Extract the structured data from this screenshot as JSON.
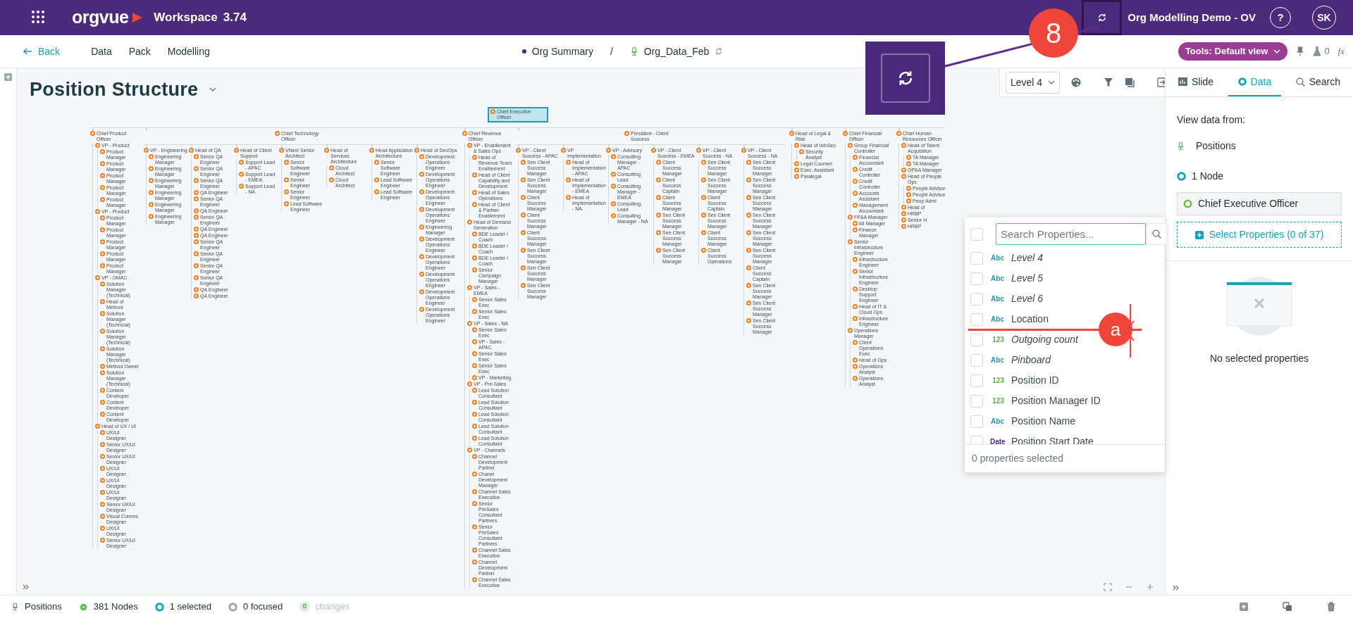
{
  "app": {
    "logo": "orgvue",
    "workspace": "Workspace",
    "version": "3.74",
    "project": "Org Modelling Demo - OV",
    "help": "?",
    "user_initials": "SK"
  },
  "annotations": {
    "step_badge": "8",
    "marker": "a"
  },
  "subnav": {
    "back": "Back",
    "links": [
      "Data",
      "Pack",
      "Modelling"
    ],
    "breadcrumb": [
      "Org Summary",
      "Org_Data_Feb"
    ],
    "separator": "/",
    "tools": "Tools: Default view",
    "flask_count": "0",
    "formula": "fx"
  },
  "view": {
    "title": "Position Structure",
    "level_select": "Level 4"
  },
  "org_chart": {
    "root": {
      "title": "Chief Executive Officer",
      "selected": true,
      "children": [
        {
          "title": "Chief Product Officer",
          "selected": false,
          "kind": "stacked",
          "children": [
            {
              "title": "VP - Product",
              "selected": false,
              "children": [
                {
                  "title": "Product Manager",
                  "selected": false
                },
                {
                  "title": "Product Manager",
                  "selected": false
                },
                {
                  "title": "Product Manager",
                  "selected": false
                },
                {
                  "title": "Product Manager",
                  "selected": false
                },
                {
                  "title": "Product Manager",
                  "selected": false
                }
              ]
            },
            {
              "title": "VP - Product",
              "selected": false,
              "children": [
                {
                  "title": "Product Manager",
                  "selected": false
                },
                {
                  "title": "Product Manager",
                  "selected": false
                },
                {
                  "title": "Product Manager",
                  "selected": false
                },
                {
                  "title": "Product Manager",
                  "selected": false
                },
                {
                  "title": "Product Manager",
                  "selected": false
                }
              ]
            },
            {
              "title": "VP - OMAC",
              "selected": false,
              "children": [
                {
                  "title": "Solution Manager (Technical)",
                  "selected": false
                },
                {
                  "title": "Head of Method",
                  "selected": false
                },
                {
                  "title": "Solution Manager (Technical)",
                  "selected": false
                },
                {
                  "title": "Solution Manager (Technical)",
                  "selected": false
                },
                {
                  "title": "Solution Manager (Technical)",
                  "selected": false
                },
                {
                  "title": "Method Owner",
                  "selected": false
                },
                {
                  "title": "Solution Manager (Technical)",
                  "selected": false
                },
                {
                  "title": "Content Developer",
                  "selected": false
                },
                {
                  "title": "Content Developer",
                  "selected": false
                },
                {
                  "title": "Content Developer",
                  "selected": false
                }
              ]
            },
            {
              "title": "Head of UX / UI",
              "selected": false,
              "children": [
                {
                  "title": "UX/UI Designer",
                  "selected": false
                },
                {
                  "title": "Senior UX/UI Designer",
                  "selected": false
                },
                {
                  "title": "Senior UX/UI Designer",
                  "selected": false
                },
                {
                  "title": "UX/UI Designer",
                  "selected": false
                },
                {
                  "title": "UX/UI Designer",
                  "selected": false
                },
                {
                  "title": "UX/UI Designer",
                  "selected": false
                },
                {
                  "title": "Senior UX/UI Designer",
                  "selected": false
                },
                {
                  "title": "Visual Comms Designer",
                  "selected": false
                },
                {
                  "title": "UX/UI Designer",
                  "selected": false
                },
                {
                  "title": "Senior UX/UI Designer",
                  "selected": false
                }
              ]
            }
          ]
        },
        {
          "title": "Chief Technology Officer",
          "selected": false,
          "kind": "spread",
          "children": [
            {
              "title": "VP - Engineering",
              "selected": false,
              "children": [
                {
                  "title": "Engineering Manager",
                  "selected": false
                },
                {
                  "title": "Engineering Manager",
                  "selected": false
                },
                {
                  "title": "Engineering Manager",
                  "selected": false
                },
                {
                  "title": "Engineering Manager",
                  "selected": false
                },
                {
                  "title": "Engineering Manager",
                  "selected": false
                },
                {
                  "title": "Engineering Manager",
                  "selected": false
                }
              ]
            },
            {
              "title": "Head of QA",
              "selected": false,
              "children": [
                {
                  "title": "Senior QA Engineer",
                  "selected": false
                },
                {
                  "title": "Senior QA Engineer",
                  "selected": false
                },
                {
                  "title": "Senior QA Engineer",
                  "selected": false
                },
                {
                  "title": "QA Engineer",
                  "selected": false
                },
                {
                  "title": "Senior QA Engineer",
                  "selected": false
                },
                {
                  "title": "QA Engineer",
                  "selected": false
                },
                {
                  "title": "Senior QA Engineer",
                  "selected": false
                },
                {
                  "title": "QA Engineer",
                  "selected": false
                },
                {
                  "title": "QA Engineer",
                  "selected": false
                },
                {
                  "title": "Senior QA Engineer",
                  "selected": false
                },
                {
                  "title": "Senior QA Engineer",
                  "selected": false
                },
                {
                  "title": "Senior QA Engineer",
                  "selected": false
                },
                {
                  "title": "Senior QA Engineer",
                  "selected": false
                },
                {
                  "title": "QA Engineer",
                  "selected": false
                },
                {
                  "title": "QA Engineer",
                  "selected": false
                }
              ]
            },
            {
              "title": "Head of Client Support",
              "selected": false,
              "children": [
                {
                  "title": "Support Lead - APAC",
                  "selected": false
                },
                {
                  "title": "Support Lead - EMEA",
                  "selected": false
                },
                {
                  "title": "Support Lead - NA",
                  "selected": false
                }
              ]
            },
            {
              "title": "VNext Senior Architect",
              "selected": false,
              "children": [
                {
                  "title": "Senior Software Engineer",
                  "selected": false
                },
                {
                  "title": "Senior Engineer",
                  "selected": false
                },
                {
                  "title": "Senior Engineer",
                  "selected": false
                },
                {
                  "title": "Lead Software Engineer",
                  "selected": false
                }
              ]
            },
            {
              "title": "Head of Services Architecture",
              "selected": false,
              "children": [
                {
                  "title": "Cloud Architect",
                  "selected": false
                },
                {
                  "title": "Cloud Architect",
                  "selected": false
                }
              ]
            },
            {
              "title": "Head Application Architecture",
              "selected": false,
              "children": [
                {
                  "title": "Senior Software Engineer",
                  "selected": false
                },
                {
                  "title": "Lead Software Engineer",
                  "selected": false
                },
                {
                  "title": "Lead Software Engineer",
                  "selected": false
                }
              ]
            },
            {
              "title": "Head of DevOps",
              "selected": false,
              "children": [
                {
                  "title": "Development Operations Engineer",
                  "selected": false
                },
                {
                  "title": "Development Operations Engineer",
                  "selected": false
                },
                {
                  "title": "Development Operations Engineer",
                  "selected": false
                },
                {
                  "title": "Development Operations Engineer",
                  "selected": false
                },
                {
                  "title": "Engineering Manager",
                  "selected": false
                },
                {
                  "title": "Development Operations Engineer",
                  "selected": false
                },
                {
                  "title": "Development Operations Engineer",
                  "selected": false
                },
                {
                  "title": "Development Operations Engineer",
                  "selected": false
                },
                {
                  "title": "Development Operations Engineer",
                  "selected": false
                },
                {
                  "title": "Development Operations Engineer",
                  "selected": false
                }
              ]
            }
          ]
        },
        {
          "title": "Chief Revenue Officer",
          "selected": false,
          "kind": "stacked",
          "children": [
            {
              "title": "VP - Enablement & Sales Ops",
              "selected": false,
              "children": [
                {
                  "title": "Head of Revenue Team Enablement",
                  "selected": false
                },
                {
                  "title": "Head of Client Capability and Development",
                  "selected": false
                },
                {
                  "title": "Head of Sales Operations",
                  "selected": false
                },
                {
                  "title": "Head of Client & Partner Enablement",
                  "selected": false
                }
              ]
            },
            {
              "title": "Head of Demand Generation",
              "selected": false,
              "children": [
                {
                  "title": "BDE Leader / Coach",
                  "selected": false
                },
                {
                  "title": "BDE Leader / Coach",
                  "selected": false
                },
                {
                  "title": "BDE Leader / Coach",
                  "selected": false
                },
                {
                  "title": "Senior Campaign Manager",
                  "selected": false
                }
              ]
            },
            {
              "title": "VP - Sales - EMEA",
              "selected": false,
              "children": [
                {
                  "title": "Senior Sales Exec",
                  "selected": false
                },
                {
                  "title": "Senior Sales Exec",
                  "selected": false
                }
              ]
            },
            {
              "title": "VP - Sales - NA",
              "selected": false,
              "children": [
                {
                  "title": "Senior Sales Exec",
                  "selected": false
                },
                {
                  "title": "VP - Sales - APAC",
                  "selected": false
                },
                {
                  "title": "Senior Sales Exec",
                  "selected": false
                },
                {
                  "title": "Senior Sales Exec",
                  "selected": false
                },
                {
                  "title": "VP - Marketing",
                  "selected": false
                }
              ]
            },
            {
              "title": "VP - Pre-Sales",
              "selected": false,
              "children": [
                {
                  "title": "Lead Solution Consultant",
                  "selected": false
                },
                {
                  "title": "Lead Solution Consultant",
                  "selected": false
                },
                {
                  "title": "Lead Solution Consultant",
                  "selected": false
                },
                {
                  "title": "Lead Solution Consultant",
                  "selected": false
                },
                {
                  "title": "Lead Solution Consultant",
                  "selected": false
                }
              ]
            },
            {
              "title": "VP - Channels",
              "selected": false,
              "children": [
                {
                  "title": "Channel Development Partner",
                  "selected": false
                },
                {
                  "title": "Chanel Development Manager",
                  "selected": false
                },
                {
                  "title": "Channel Sales Executive",
                  "selected": false
                },
                {
                  "title": "Senior PreSales Consultant Partners",
                  "selected": false
                },
                {
                  "title": "Senior PreSales Consultant Partners",
                  "selected": false
                },
                {
                  "title": "Channel Sales Executive",
                  "selected": false
                },
                {
                  "title": "Channel Development Partner",
                  "selected": false
                },
                {
                  "title": "Channel Sales Executive",
                  "selected": false
                }
              ]
            }
          ]
        },
        {
          "title": "President - Client Success",
          "selected": false,
          "kind": "spread",
          "children": [
            {
              "title": "VP - Client Success - APAC",
              "selected": false,
              "children": [
                {
                  "title": "Sen Client Success Manager",
                  "selected": false
                },
                {
                  "title": "Sen Client Success Manager",
                  "selected": false
                },
                {
                  "title": "Client Success Manager",
                  "selected": false
                },
                {
                  "title": "Client Success Manager",
                  "selected": false
                },
                {
                  "title": "Client Success Manager",
                  "selected": false
                },
                {
                  "title": "Sen Client Success Manager",
                  "selected": false
                },
                {
                  "title": "Sen Client Success Manager",
                  "selected": false
                },
                {
                  "title": "Sen Client Success Manager",
                  "selected": false
                }
              ]
            },
            {
              "title": "VP Implementation",
              "selected": false,
              "children": [
                {
                  "title": "Head of Implementation - APAC",
                  "selected": false
                },
                {
                  "title": "Head of Implementation - EMEA",
                  "selected": false
                },
                {
                  "title": "Head of Implementation - NA",
                  "selected": false
                }
              ]
            },
            {
              "title": "VP - Advisory",
              "selected": false,
              "children": [
                {
                  "title": "Consulting Manager - APAC",
                  "selected": false
                },
                {
                  "title": "Consulting Lead",
                  "selected": false
                },
                {
                  "title": "Consulting Manager - EMEA",
                  "selected": false
                },
                {
                  "title": "Consulting Lead",
                  "selected": false
                },
                {
                  "title": "Consulting Manager - NA",
                  "selected": false
                }
              ]
            },
            {
              "title": "VP - Client Success - EMEA",
              "selected": false,
              "children": [
                {
                  "title": "Client Success Manager",
                  "selected": false
                },
                {
                  "title": "Client Success Captain",
                  "selected": false
                },
                {
                  "title": "Client Success Manager",
                  "selected": false
                },
                {
                  "title": "Sen Client Success Manager",
                  "selected": false
                },
                {
                  "title": "Sen Client Success Manager",
                  "selected": false
                },
                {
                  "title": "Sen Client Success Manager",
                  "selected": false
                }
              ]
            },
            {
              "title": "VP - Client Success - NA",
              "selected": false,
              "children": [
                {
                  "title": "Sen Client Success Manager",
                  "selected": false
                },
                {
                  "title": "Sen Client Success Manager",
                  "selected": false
                },
                {
                  "title": "Client Success Captain",
                  "selected": false
                },
                {
                  "title": "Sen Client Success Manager",
                  "selected": false
                },
                {
                  "title": "Client Success Manager",
                  "selected": false
                },
                {
                  "title": "Client Success Operations",
                  "selected": false
                }
              ]
            },
            {
              "title": "VP - Client Success - NA",
              "selected": false,
              "children": [
                {
                  "title": "Sen Client Success Manager",
                  "selected": false
                },
                {
                  "title": "Sen Client Success Manager",
                  "selected": false
                },
                {
                  "title": "Sen Client Success Manager",
                  "selected": false
                },
                {
                  "title": "Sen Client Success Manager",
                  "selected": false
                },
                {
                  "title": "Sen Client Success Manager",
                  "selected": false
                },
                {
                  "title": "Sen Client Success Manager",
                  "selected": false
                },
                {
                  "title": "Client Success Captain",
                  "selected": false
                },
                {
                  "title": "Sen Client Success Manager",
                  "selected": false
                },
                {
                  "title": "Sen Client Success Manager",
                  "selected": false
                },
                {
                  "title": "Sen Client Success Manager",
                  "selected": false
                }
              ]
            }
          ]
        },
        {
          "title": "Head of Legal & Risk",
          "selected": false,
          "kind": "stacked",
          "children": [
            {
              "title": "Head of InfoSec",
              "selected": false,
              "children": [
                {
                  "title": "Security Analyst",
                  "selected": false
                }
              ]
            },
            {
              "title": "Legal Counsel",
              "selected": false
            },
            {
              "title": "Exec. Assistant",
              "selected": false
            },
            {
              "title": "Paralegal",
              "selected": false
            }
          ]
        },
        {
          "title": "Chief Financial Officer",
          "selected": false,
          "kind": "stacked",
          "children": [
            {
              "title": "Group Financial Controller",
              "selected": false,
              "children": [
                {
                  "title": "Financial Accountant",
                  "selected": false
                },
                {
                  "title": "Credit Controller",
                  "selected": false
                },
                {
                  "title": "Credit Controller",
                  "selected": false
                },
                {
                  "title": "Accounts Assistant",
                  "selected": false
                },
                {
                  "title": "Management Accountant",
                  "selected": false
                }
              ]
            },
            {
              "title": "FP&A Manager",
              "selected": false,
              "children": [
                {
                  "title": "MI Manager",
                  "selected": false
                },
                {
                  "title": "Finance Manager",
                  "selected": false
                }
              ]
            },
            {
              "title": "Senior Infrastructure Engineer",
              "selected": false,
              "children": [
                {
                  "title": "Infrastructure Engineer",
                  "selected": false
                },
                {
                  "title": "Senior Infrastructure Engineer",
                  "selected": false
                },
                {
                  "title": "Desktop Support Engineer",
                  "selected": false
                },
                {
                  "title": "Head of IT & Cloud Ops",
                  "selected": false
                },
                {
                  "title": "Infrastructure Engineer",
                  "selected": false
                }
              ]
            },
            {
              "title": "Operations Manager",
              "selected": false,
              "children": [
                {
                  "title": "Client Operations Exec",
                  "selected": false
                },
                {
                  "title": "Head of Ops",
                  "selected": false
                },
                {
                  "title": "Operations Analyst",
                  "selected": false
                },
                {
                  "title": "Operations Analyst",
                  "selected": false
                }
              ]
            }
          ]
        },
        {
          "title": "Chief Human Resources Officer",
          "selected": false,
          "kind": "stacked",
          "children": [
            {
              "title": "Head of Talent Acquisition",
              "selected": false,
              "children": [
                {
                  "title": "TA Manager",
                  "selected": false
                },
                {
                  "title": "TA Manager",
                  "selected": false
                }
              ]
            },
            {
              "title": "OP&A Manager",
              "selected": false
            },
            {
              "title": "Head of People Ops",
              "selected": false,
              "children": [
                {
                  "title": "People Advisor",
                  "selected": false
                },
                {
                  "title": "People Advisor",
                  "selected": false
                },
                {
                  "title": "Peop Admi",
                  "selected": false
                }
              ]
            },
            {
              "title": "Head of",
              "selected": false
            },
            {
              "title": "HRBP",
              "selected": false
            },
            {
              "title": "Senior H",
              "selected": false
            },
            {
              "title": "HRBP",
              "selected": false
            }
          ]
        }
      ]
    }
  },
  "side_panel": {
    "tabs": [
      {
        "label": "Slide",
        "selected": false
      },
      {
        "label": "Data",
        "selected": true
      },
      {
        "label": "Search",
        "selected": false
      }
    ],
    "view_from_label": "View data from:",
    "dataset": "Positions",
    "node_count": "1 Node",
    "selected_node": "Chief Executive Officer",
    "select_properties": "Select Properties",
    "properties_count": "(0 of 37)",
    "empty_message": "No selected properties"
  },
  "property_picker": {
    "placeholder": "Search Properties...",
    "all_checked": false,
    "items": [
      {
        "kind": "text",
        "type_label": "Abc",
        "label": "Level 4",
        "italic": true,
        "checked": false
      },
      {
        "kind": "text",
        "type_label": "Abc",
        "label": "Level 5",
        "italic": true,
        "checked": false
      },
      {
        "kind": "text",
        "type_label": "Abc",
        "label": "Level 6",
        "italic": true,
        "checked": false
      },
      {
        "kind": "text",
        "type_label": "Abc",
        "label": "Location",
        "italic": false,
        "checked": false
      },
      {
        "kind": "number",
        "type_label": "123",
        "label": "Outgoing count",
        "italic": true,
        "checked": false
      },
      {
        "kind": "text",
        "type_label": "Abc",
        "label": "Pinboard",
        "italic": true,
        "checked": false
      },
      {
        "kind": "number",
        "type_label": "123",
        "label": "Position ID",
        "italic": false,
        "checked": false
      },
      {
        "kind": "number",
        "type_label": "123",
        "label": "Position Manager ID",
        "italic": false,
        "checked": false
      },
      {
        "kind": "text",
        "type_label": "Abc",
        "label": "Position Name",
        "italic": false,
        "checked": false
      },
      {
        "kind": "date",
        "type_label": "Date",
        "label": "Position Start Date",
        "italic": false,
        "checked": false
      }
    ],
    "footer": "0 properties selected"
  },
  "status_bar": {
    "dataset": "Positions",
    "nodes": "381 Nodes",
    "selected": "1 selected",
    "focused": "0 focused",
    "changes_count": "0",
    "changes": "changes"
  }
}
